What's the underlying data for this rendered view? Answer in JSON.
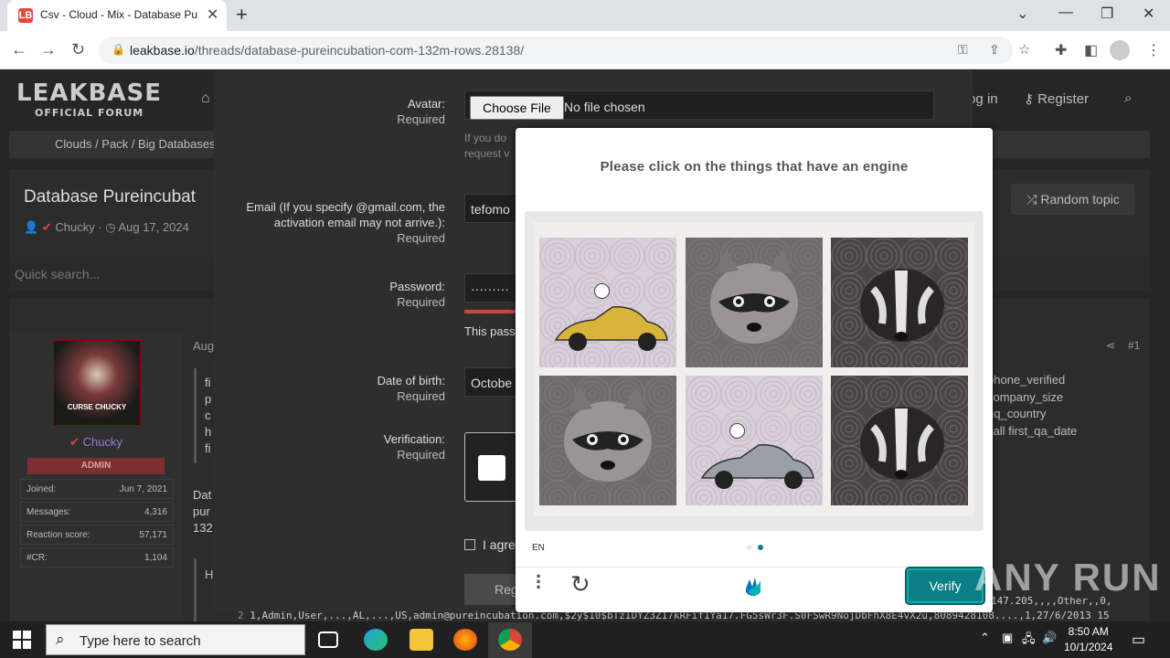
{
  "browser": {
    "tab_title": "Csv - Cloud - Mix - Database Pu",
    "url_host": "leakbase.io",
    "url_path": "/threads/database-pureincubation-com-132m-rows.28138/",
    "favicon_text": "LB"
  },
  "site": {
    "logo_line1": "LEAKBASE",
    "logo_line2": "OFFICIAL FORUM",
    "login": "Log in",
    "register": "Register",
    "breadcrumb": "Clouds / Pack / Big Databases",
    "thread_title": "Database Pureincubat",
    "thread_author": "Chucky",
    "thread_date": "Aug 17, 2024",
    "random_topic": "Random topic",
    "quick_search_placeholder": "Quick search...",
    "post_date_fragment": "Aug",
    "post_number": "#1"
  },
  "user_card": {
    "name": "Chucky",
    "role": "ADMIN",
    "avatar_text": "CURSE CHUCKY",
    "stats": [
      {
        "label": "Joined:",
        "value": "Jun 7, 2021"
      },
      {
        "label": "Messages:",
        "value": "4,316"
      },
      {
        "label": "Reaction score:",
        "value": "57,171"
      },
      {
        "label": "#CR:",
        "value": "1,104"
      }
    ]
  },
  "post_right_lines": [
    "phone_verified",
    "company_size",
    "hq_country",
    "call first_qa_date"
  ],
  "post_left_fragments": [
    "fi",
    "p",
    "c",
    "h",
    "fi"
  ],
  "post_body_fragments": [
    "Dat",
    "pur",
    "132"
  ],
  "code_line": "1,Admin,User,...,AL,...,US,admin@pureincubation.com,$2y$10$bTzIDYZ3Z17kRFif1Ya17.FG5sWr3F.S0FSwR9NojDbFhX8E4vX2u,8089428108....,1,27/6/2013 15",
  "code_right": "147.205,,,,Other,,0,",
  "register_form": {
    "avatar_label": "Avatar:",
    "required": "Required",
    "choose_file": "Choose File",
    "no_file": "No file chosen",
    "help_text": "If you do\nrequest v",
    "email_label": "Email (If you specify @gmail.com, the activation email may not arrive.):",
    "email_value": "tefomo",
    "password_label": "Password:",
    "password_value": "·········",
    "password_strength": "This pass",
    "dob_label": "Date of birth:",
    "dob_value": "Octobe",
    "verification_label": "Verification:",
    "agree_text": "I agre",
    "register_button": "Reg"
  },
  "captcha": {
    "question": "Please click on the things that have an engine",
    "language": "EN",
    "verify": "Verify",
    "page_dots": 2,
    "active_dot": 1,
    "accent_color": "#0a7f86",
    "tiles": [
      {
        "subject": "car",
        "selected": true
      },
      {
        "subject": "raccoon",
        "selected": false
      },
      {
        "subject": "badger",
        "selected": false
      },
      {
        "subject": "raccoon",
        "selected": false
      },
      {
        "subject": "car",
        "selected": true
      },
      {
        "subject": "badger",
        "selected": false
      }
    ]
  },
  "watermark": "ANY RUN",
  "taskbar": {
    "search_placeholder": "Type here to search",
    "time": "8:50 AM",
    "date": "10/1/2024"
  }
}
